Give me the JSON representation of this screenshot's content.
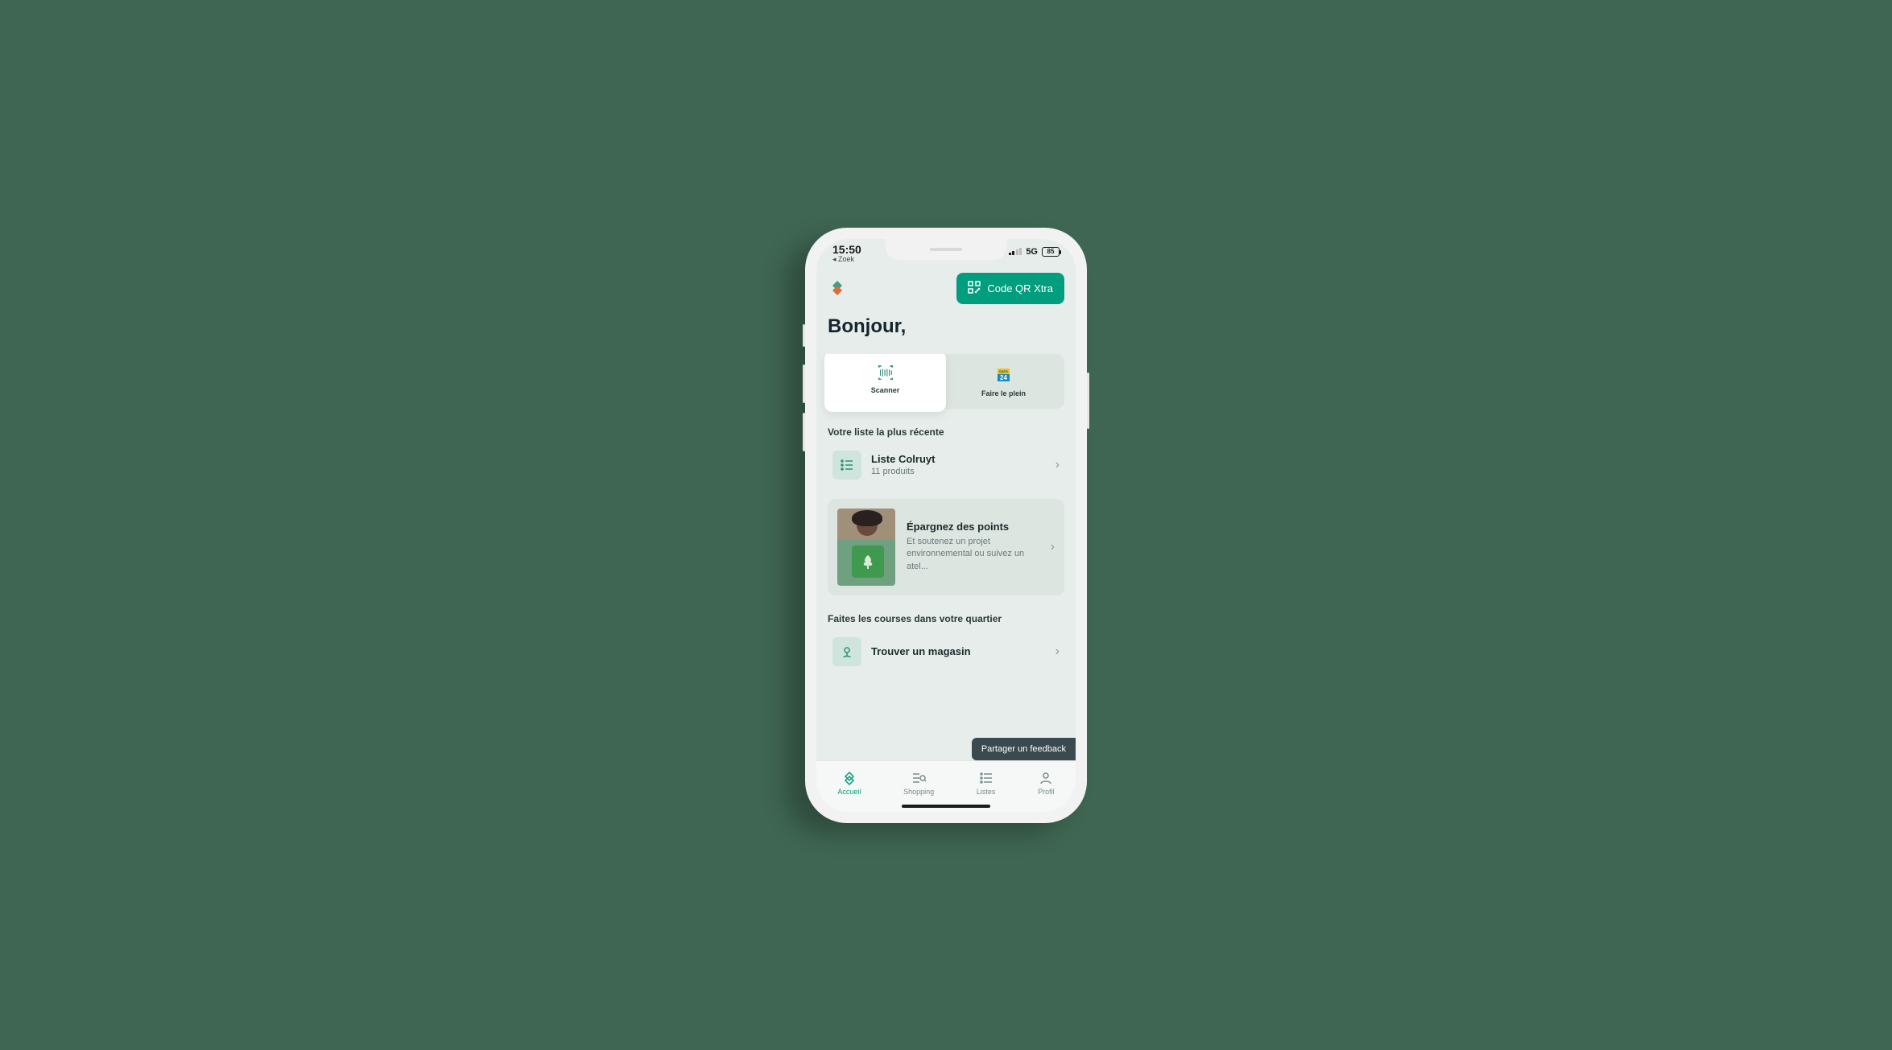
{
  "status": {
    "time": "15:50",
    "back_label": "◂ Zoek",
    "network": "5G",
    "battery": "85"
  },
  "header": {
    "qr_button": "Code QR Xtra"
  },
  "greeting": "Bonjour,",
  "actions": {
    "scanner": "Scanner",
    "dats": "Faire le plein",
    "dats_badge_top": "DATS",
    "dats_badge_num": "24"
  },
  "recent_list": {
    "section_title": "Votre liste la plus récente",
    "name": "Liste Colruyt",
    "sub": "11 produits"
  },
  "promo": {
    "title": "Épargnez des points",
    "desc": "Et soutenez un projet environnemental ou suivez un atel..."
  },
  "stores": {
    "section_title": "Faites les courses dans votre quartier",
    "find": "Trouver un magasin"
  },
  "feedback": "Partager un feedback",
  "tabs": {
    "home": "Accueil",
    "shopping": "Shopping",
    "lists": "Listes",
    "profile": "Profil"
  }
}
